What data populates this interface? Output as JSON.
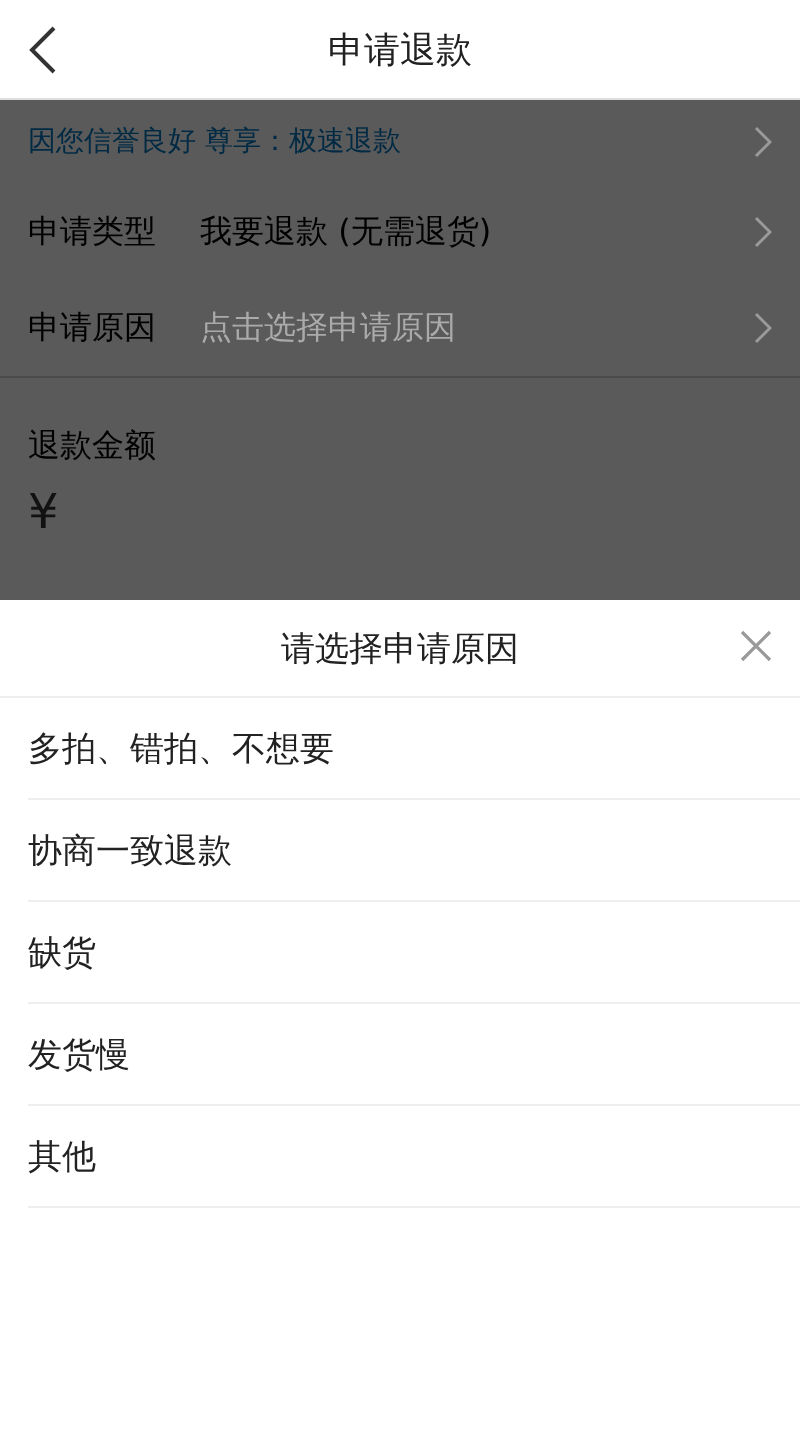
{
  "header": {
    "title": "申请退款"
  },
  "page": {
    "notice": "因您信誉良好 尊享：极速退款",
    "fields": [
      {
        "label": "申请类型",
        "value": "我要退款 (无需退货)"
      },
      {
        "label": "申请原因",
        "placeholder": "点击选择申请原因"
      }
    ],
    "amount": {
      "label": "退款金额",
      "currency": "¥"
    }
  },
  "sheet": {
    "title": "请选择申请原因",
    "options": [
      "多拍、错拍、不想要",
      "协商一致退款",
      "缺货",
      "发货慢",
      "其他"
    ]
  }
}
